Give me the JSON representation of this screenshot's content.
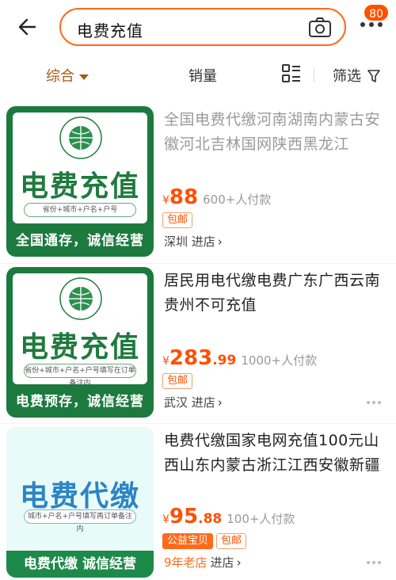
{
  "header": {
    "search_value": "电费充值",
    "badge_count": "80",
    "icons": [
      "back-arrow-icon",
      "camera-icon",
      "more-icon"
    ]
  },
  "sortbar": {
    "items": [
      "综合",
      "销量",
      "筛选"
    ],
    "active_color": "#a55a14"
  },
  "products": [
    {
      "title": "全国电费代缴河南湖南内蒙古安徽河北吉林国网陕西黑龙江",
      "price_int": "88",
      "price_dec": "",
      "sold": "600+人付款",
      "tags": [
        "包邮"
      ],
      "shop_prefix": "",
      "shop": "深圳 进店",
      "thumb": {
        "title": "电费充值",
        "pill": "省份+城市+户名+户号",
        "footer": "全国通存，诚信经营"
      }
    },
    {
      "title": "居民用电代缴电费广东广西云南贵州不可充值",
      "price_int": "283",
      "price_dec": ".99",
      "sold": "1000+人付款",
      "tags": [
        "包邮"
      ],
      "shop_prefix": "",
      "shop": "武汉 进店",
      "thumb": {
        "title": "电费充值",
        "pill": "省份+城市+户名+户号填写在订单备注内",
        "footer": "电费预存，诚信经营"
      }
    },
    {
      "title": "电费代缴国家电网充值100元山西山东内蒙古浙江江西安徽新疆",
      "price_int": "95",
      "price_dec": ".88",
      "sold": "100+人付款",
      "tags": [
        "公益宝贝",
        "包邮"
      ],
      "shop_prefix": "9年老店",
      "shop": "进店",
      "thumb": {
        "title": "电费代缴",
        "pill": "城市+户名+户号填写再订单备注内",
        "footer": "电费代缴 诚信经营"
      }
    }
  ],
  "colors": {
    "accent": "#ff5000",
    "brand_green": "#1d7a3f"
  }
}
